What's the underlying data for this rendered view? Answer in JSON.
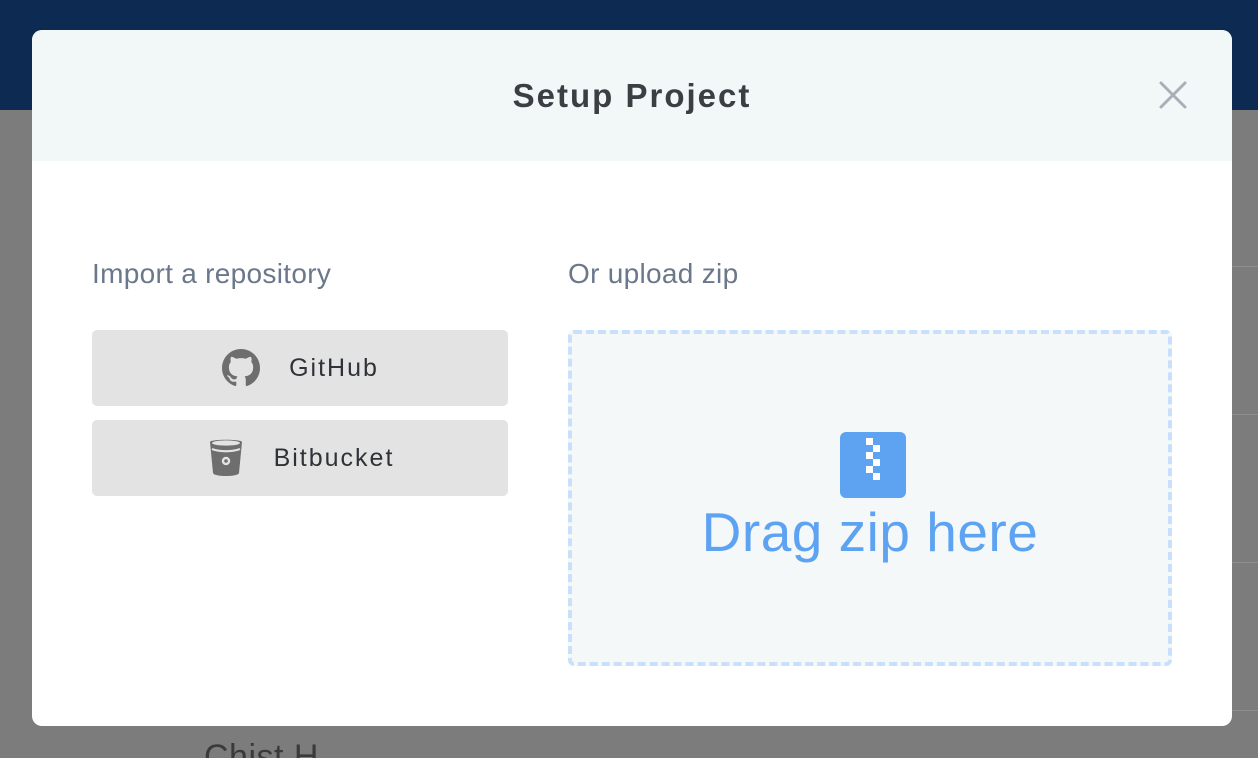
{
  "background": {
    "partial_text": "Chist H"
  },
  "modal": {
    "title": "Setup Project",
    "close_icon": "close-icon",
    "import": {
      "label": "Import a repository",
      "buttons": [
        {
          "label": "GitHub",
          "icon": "github-icon"
        },
        {
          "label": "Bitbucket",
          "icon": "bitbucket-icon"
        }
      ]
    },
    "upload": {
      "label": "Or upload zip",
      "dropzone_text": "Drag zip here",
      "icon": "zip-file-icon"
    }
  },
  "colors": {
    "topbar": "#0d2b52",
    "header_bg": "#f2f7f7",
    "accent_blue": "#5ea2f2",
    "dropzone_border": "#c8e0fb",
    "button_bg": "#e3e3e3"
  }
}
